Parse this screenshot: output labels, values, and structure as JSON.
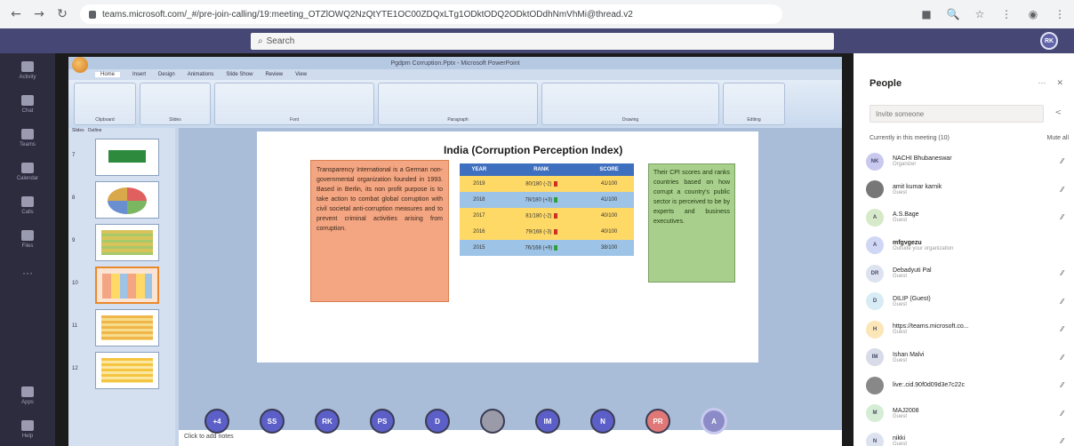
{
  "browser": {
    "url": "teams.microsoft.com/_#/pre-join-calling/19:meeting_OTZlOWQ2NzQtYTE1OC00ZDQxLTg1ODktODQ2ODktODdhNmVhMi@thread.v2",
    "nav": [
      "←",
      "→",
      "↻"
    ],
    "right_icons": [
      "■",
      "🔍",
      "☆",
      "⋮",
      "◉",
      "⋮"
    ]
  },
  "teams": {
    "search_placeholder": "Search",
    "me_initials": "RK",
    "rail": [
      "Activity",
      "Chat",
      "Teams",
      "Calendar",
      "Calls",
      "Files",
      "···",
      "Apps",
      "Help"
    ]
  },
  "ppt": {
    "window_title": "Pgdpm Corruption.Pptx - Microsoft PowerPoint",
    "tabs": [
      "Home",
      "Insert",
      "Design",
      "Animations",
      "Slide Show",
      "Review",
      "View"
    ],
    "groups": [
      "Clipboard",
      "Slides",
      "Font",
      "Paragraph",
      "Drawing",
      "Editing"
    ],
    "pane_tabs": [
      "Slides",
      "Outline"
    ],
    "thumb_numbers": [
      "7",
      "8",
      "9",
      "10",
      "11",
      "12"
    ],
    "notes_placeholder": "Click to add notes"
  },
  "slide": {
    "title": "India (Corruption Perception Index)",
    "left_text": "Transparency International is a German non-governmental organization founded in 1993. Based in Berlin, its non profit purpose is to take action to combat global corruption with civil societal anti-corruption measures and to prevent criminal activities arising from corruption.",
    "right_text": "Their CPI scores and ranks countries based on how corrupt a country's public sector is perceived to be by experts and business executives.",
    "table": {
      "headers": [
        "YEAR",
        "RANK",
        "SCORE"
      ],
      "rows": [
        {
          "year": "2019",
          "rank": "80/180 (-2)",
          "score": "41/100",
          "trend": "down"
        },
        {
          "year": "2018",
          "rank": "78/180 (+3)",
          "score": "41/100",
          "trend": "up"
        },
        {
          "year": "2017",
          "rank": "81/180 (-2)",
          "score": "40/100",
          "trend": "down"
        },
        {
          "year": "2016",
          "rank": "79/168 (-3)",
          "score": "40/100",
          "trend": "down"
        },
        {
          "year": "2015",
          "rank": "76/168 (+9)",
          "score": "38/100",
          "trend": "up"
        }
      ]
    }
  },
  "participants_strip": [
    "+4",
    "SS",
    "RK",
    "PS",
    "D",
    "",
    "IM",
    "N",
    "PR",
    "A"
  ],
  "people": {
    "title": "People",
    "invite_placeholder": "Invite someone",
    "section_label": "Currently in this meeting (10)",
    "mute_all": "Mute all",
    "list": [
      {
        "initials": "NK",
        "name": "NACHI Bhubaneswar",
        "role": "Organizer",
        "color": "#c9c9f0"
      },
      {
        "initials": "",
        "name": "amit kumar karnik",
        "role": "Guest",
        "color": "#777777"
      },
      {
        "initials": "A",
        "name": "A.S.Bage",
        "role": "Guest",
        "color": "#d6e9c8"
      },
      {
        "initials": "A",
        "name": "mfgvgezu",
        "role": "Outside your organization",
        "color": "#d0d7f5"
      },
      {
        "initials": "DR",
        "name": "Debadyuti Pal",
        "role": "Guest",
        "color": "#dde2f0"
      },
      {
        "initials": "D",
        "name": "DILIP (Guest)",
        "role": "Guest",
        "color": "#d8ecf5"
      },
      {
        "initials": "H",
        "name": "https://teams.microsoft.co...",
        "role": "Guest",
        "color": "#fbe6b8"
      },
      {
        "initials": "IM",
        "name": "Ishan Malvi",
        "role": "Guest",
        "color": "#d8dbe8"
      },
      {
        "initials": "",
        "name": "live:.cid.90f0d09d3e7c22c",
        "role": "",
        "color": "#888888"
      },
      {
        "initials": "M",
        "name": "MAJ2008",
        "role": "Guest",
        "color": "#d4edd4"
      },
      {
        "initials": "N",
        "name": "nikki",
        "role": "Guest",
        "color": "#dde2f0"
      }
    ]
  }
}
